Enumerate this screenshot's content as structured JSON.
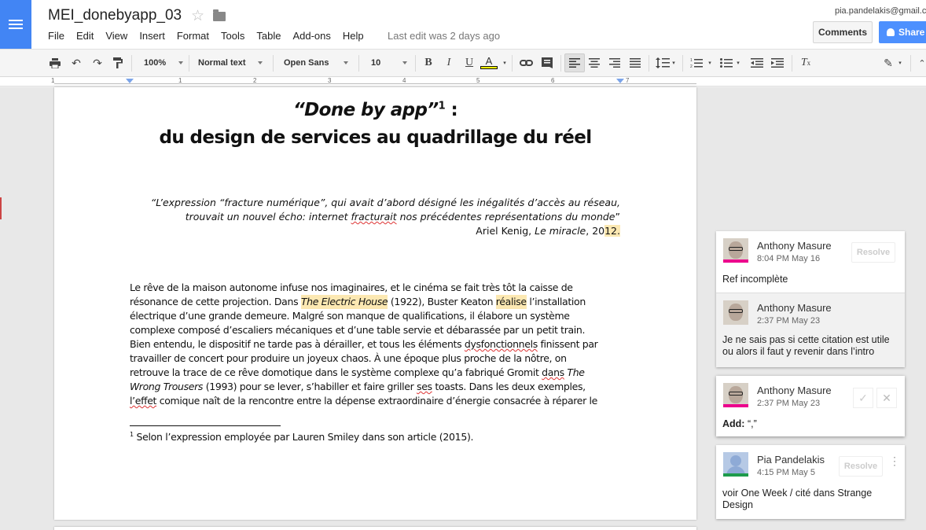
{
  "app": {
    "doc_title": "MEI_donebyapp_03",
    "last_edit": "Last edit was 2 days ago",
    "user_email": "pia.pandelakis@gmail.co",
    "comments_label": "Comments",
    "share_label": "Share",
    "menus": [
      "File",
      "Edit",
      "View",
      "Insert",
      "Format",
      "Tools",
      "Table",
      "Add-ons",
      "Help"
    ]
  },
  "toolbar": {
    "zoom": "100%",
    "style": "Normal text",
    "font": "Open Sans",
    "size": "10",
    "icons": [
      "print-icon",
      "undo-icon",
      "redo-icon",
      "paint-format-icon",
      "bold-icon",
      "italic-icon",
      "underline-icon",
      "text-color-icon",
      "link-icon",
      "comment-icon",
      "align-left-icon",
      "align-center-icon",
      "align-right-icon",
      "justify-icon",
      "line-spacing-icon",
      "numbered-list-icon",
      "bulleted-list-icon",
      "decrease-indent-icon",
      "increase-indent-icon",
      "clear-formatting-icon",
      "pencil-icon"
    ],
    "text_color": "#ffff00"
  },
  "ruler": {
    "numbers": [
      "1",
      "1",
      "2",
      "3",
      "4",
      "5",
      "6",
      "7"
    ]
  },
  "document": {
    "title_main": "“Done by app”",
    "title_sup": "1",
    "title_colon": " :",
    "subtitle": "du design de services au quadrillage du réel",
    "epigraph": {
      "part1": "“L’expression “fracture numérique”, qui avait d’abord désigné les inégalités d’accès au réseau, trouvait un nouvel écho: internet ",
      "spell": "fracturait",
      "part2": " nos précédentes représentations du monde",
      "closing": "”"
    },
    "attribution": {
      "author": "Ariel Kenig, ",
      "work": "Le miracle",
      "year_a": ", 20",
      "year_hl": "12."
    },
    "paragraph_lines": [
      [
        "Le rêve de la maison autonome infuse nos imaginaires, et le cinéma se fait très tôt la caisse de"
      ],
      [
        "résonance de cette projection. Dans ",
        "The Electric House",
        " (1922), Buster Keaton ",
        "réalise",
        " l’installation"
      ],
      [
        "électrique d’une grande demeure. Malgré son manque de qualifications, il élabore un système"
      ],
      [
        "complexe composé d’escaliers mécaniques et d’une table servie et débarassée par un petit train."
      ],
      [
        "Bien entendu, le dispositif ne tarde pas à dérailler, et tous les éléments ",
        "dysfonctionnels",
        " finissent par"
      ],
      [
        "travailler de concert pour produire un joyeux chaos. À une époque plus proche de la nôtre, on"
      ],
      [
        "retrouve la trace de ce rêve domotique dans le système complexe qu’a fabriqué Gromit ",
        "dans",
        " The"
      ],
      [
        "Wrong Trousers",
        " (1993) pour se lever, s’habiller et faire griller ",
        "ses",
        " toasts. Dans les deux exemples,"
      ],
      [
        "l’effet",
        " comique naît de la rencontre entre la dépense extraordinaire d’énergie consacrée à réparer le"
      ]
    ],
    "footnote_num": "1",
    "footnote": " Selon l’expression employée par Lauren Smiley dans son article (2015)."
  },
  "comments": [
    {
      "thread": [
        {
          "author": "Anthony Masure",
          "time": "8:04 PM May 16",
          "text": "Ref incomplète",
          "action": "Resolve"
        },
        {
          "author": "Anthony Masure",
          "time": "2:37 PM May 23",
          "text": "Je ne sais pas si cette citation est utile ou alors il faut y revenir dans l’intro"
        }
      ]
    },
    {
      "thread": [
        {
          "author": "Anthony Masure",
          "time": "2:37 PM May 23",
          "label": "Add:",
          "text": " “,”",
          "accept": "✓",
          "reject": "✕"
        }
      ]
    },
    {
      "thread": [
        {
          "author": "Pia Pandelakis",
          "time": "4:15 PM May 5",
          "text": "voir One Week / cité dans Strange Design",
          "action": "Resolve"
        }
      ]
    }
  ],
  "colors": {
    "brand": "#4285f4",
    "share": "#4d90fe",
    "highlight": "#fce8b2",
    "anthony_bar": "#ec008c",
    "pia_bar": "#1e9b4c"
  }
}
